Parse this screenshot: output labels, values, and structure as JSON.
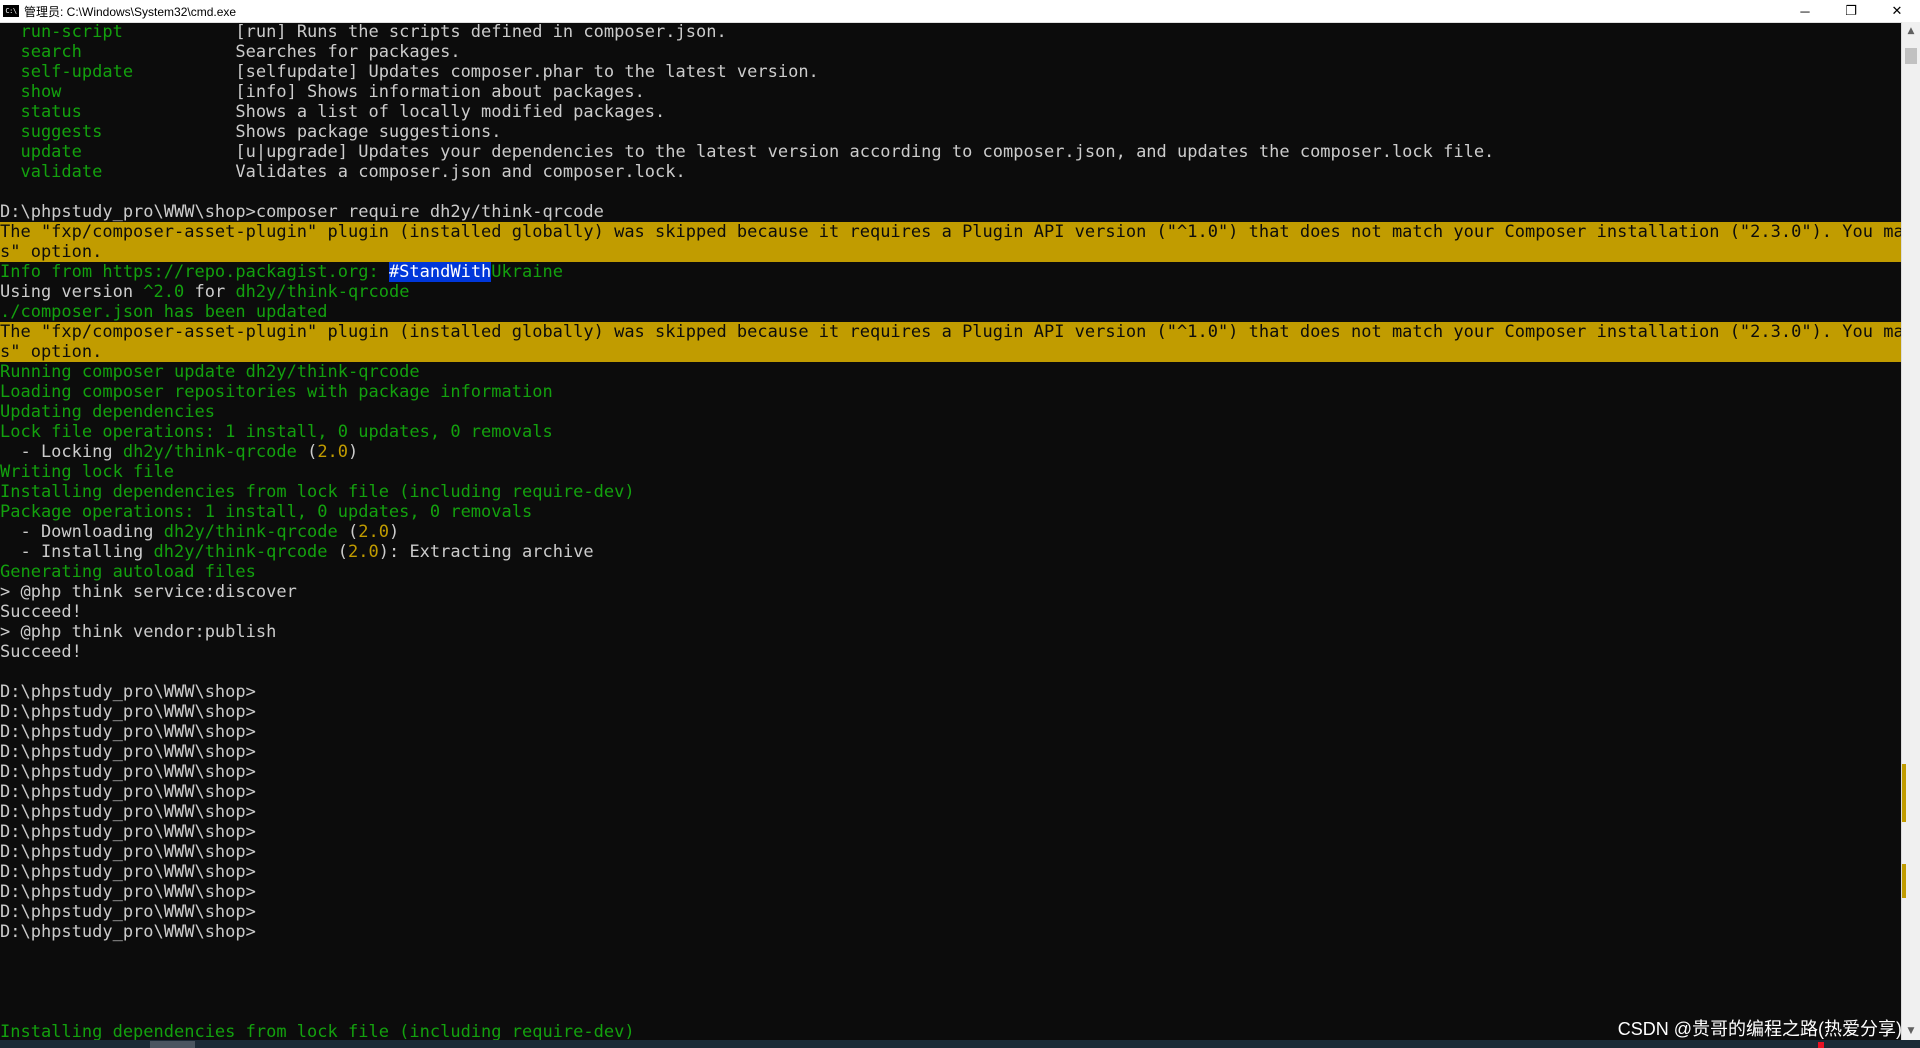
{
  "window": {
    "title": "管理员: C:\\Windows\\System32\\cmd.exe",
    "icon_label": "C:\\",
    "minimize": "─",
    "maximize": "❐",
    "close": "✕"
  },
  "console": {
    "lines": [
      {
        "segments": [
          {
            "text": "  run-script           ",
            "color": "g"
          },
          {
            "text": "[run] Runs the scripts defined in composer.json."
          }
        ]
      },
      {
        "segments": [
          {
            "text": "  search               ",
            "color": "g"
          },
          {
            "text": "Searches for packages."
          }
        ]
      },
      {
        "segments": [
          {
            "text": "  self-update          ",
            "color": "g"
          },
          {
            "text": "[selfupdate] Updates composer.phar to the latest version."
          }
        ]
      },
      {
        "segments": [
          {
            "text": "  show                 ",
            "color": "g"
          },
          {
            "text": "[info] Shows information about packages."
          }
        ]
      },
      {
        "segments": [
          {
            "text": "  status               ",
            "color": "g"
          },
          {
            "text": "Shows a list of locally modified packages."
          }
        ]
      },
      {
        "segments": [
          {
            "text": "  suggests             ",
            "color": "g"
          },
          {
            "text": "Shows package suggestions."
          }
        ]
      },
      {
        "segments": [
          {
            "text": "  update               ",
            "color": "g"
          },
          {
            "text": "[u|upgrade] Updates your dependencies to the latest version according to composer.json, and updates the composer.lock file."
          }
        ]
      },
      {
        "segments": [
          {
            "text": "  validate             ",
            "color": "g"
          },
          {
            "text": "Validates a composer.json and composer.lock."
          }
        ]
      },
      {
        "segments": [
          {
            "text": ""
          }
        ]
      },
      {
        "segments": [
          {
            "text": "D:\\phpstudy_pro\\WWW\\shop>composer require dh2y/think-qrcode"
          }
        ]
      },
      {
        "style": "warn",
        "segments": [
          {
            "text": "The \"fxp/composer-asset-plugin\" plugin (installed globally) was skipped because it requires a Plugin API version (\"^1.0\") that does not match your Composer installation (\"2.3.0\"). You may ne"
          }
        ]
      },
      {
        "style": "warn",
        "segments": [
          {
            "text": "s\" option."
          }
        ]
      },
      {
        "segments": [
          {
            "text": "Info from https://repo.packagist.org: ",
            "color": "g"
          },
          {
            "text": "#StandWith",
            "color": "hl"
          },
          {
            "text": "Ukraine",
            "color": "g"
          }
        ]
      },
      {
        "segments": [
          {
            "text": "Using version "
          },
          {
            "text": "^2.0",
            "color": "g"
          },
          {
            "text": " for "
          },
          {
            "text": "dh2y/think-qrcode",
            "color": "g"
          }
        ]
      },
      {
        "segments": [
          {
            "text": "./composer.json has been updated",
            "color": "g"
          }
        ]
      },
      {
        "style": "warn",
        "segments": [
          {
            "text": "The \"fxp/composer-asset-plugin\" plugin (installed globally) was skipped because it requires a Plugin API version (\"^1.0\") that does not match your Composer installation (\"2.3.0\"). You may ne"
          }
        ]
      },
      {
        "style": "warn",
        "segments": [
          {
            "text": "s\" option."
          }
        ]
      },
      {
        "segments": [
          {
            "text": "Running composer update dh2y/think-qrcode",
            "color": "g"
          }
        ]
      },
      {
        "segments": [
          {
            "text": "Loading composer repositories with package information",
            "color": "g"
          }
        ]
      },
      {
        "segments": [
          {
            "text": "Updating dependencies",
            "color": "g"
          }
        ]
      },
      {
        "segments": [
          {
            "text": "Lock file operations: 1 install, 0 updates, 0 removals",
            "color": "g"
          }
        ]
      },
      {
        "segments": [
          {
            "text": "  - Locking "
          },
          {
            "text": "dh2y/think-qrcode",
            "color": "g"
          },
          {
            "text": " ("
          },
          {
            "text": "2.0",
            "color": "y"
          },
          {
            "text": ")"
          }
        ]
      },
      {
        "segments": [
          {
            "text": "Writing lock file",
            "color": "g"
          }
        ]
      },
      {
        "segments": [
          {
            "text": "Installing dependencies from lock file (including require-dev)",
            "color": "g"
          }
        ]
      },
      {
        "segments": [
          {
            "text": "Package operations: 1 install, 0 updates, 0 removals",
            "color": "g"
          }
        ]
      },
      {
        "segments": [
          {
            "text": "  - Downloading "
          },
          {
            "text": "dh2y/think-qrcode",
            "color": "g"
          },
          {
            "text": " ("
          },
          {
            "text": "2.0",
            "color": "y"
          },
          {
            "text": ")"
          }
        ]
      },
      {
        "segments": [
          {
            "text": "  - Installing "
          },
          {
            "text": "dh2y/think-qrcode",
            "color": "g"
          },
          {
            "text": " ("
          },
          {
            "text": "2.0",
            "color": "y"
          },
          {
            "text": "): Extracting archive"
          }
        ]
      },
      {
        "segments": [
          {
            "text": "Generating autoload files",
            "color": "g"
          }
        ]
      },
      {
        "segments": [
          {
            "text": "> @php think service:discover"
          }
        ]
      },
      {
        "segments": [
          {
            "text": "Succeed!"
          }
        ]
      },
      {
        "segments": [
          {
            "text": "> @php think vendor:publish"
          }
        ]
      },
      {
        "segments": [
          {
            "text": "Succeed!"
          }
        ]
      },
      {
        "segments": [
          {
            "text": ""
          }
        ]
      },
      {
        "segments": [
          {
            "text": "D:\\phpstudy_pro\\WWW\\shop>"
          }
        ]
      },
      {
        "segments": [
          {
            "text": "D:\\phpstudy_pro\\WWW\\shop>"
          }
        ]
      },
      {
        "segments": [
          {
            "text": "D:\\phpstudy_pro\\WWW\\shop>"
          }
        ]
      },
      {
        "segments": [
          {
            "text": "D:\\phpstudy_pro\\WWW\\shop>"
          }
        ]
      },
      {
        "segments": [
          {
            "text": "D:\\phpstudy_pro\\WWW\\shop>"
          }
        ]
      },
      {
        "segments": [
          {
            "text": "D:\\phpstudy_pro\\WWW\\shop>"
          }
        ]
      },
      {
        "segments": [
          {
            "text": "D:\\phpstudy_pro\\WWW\\shop>"
          }
        ]
      },
      {
        "segments": [
          {
            "text": "D:\\phpstudy_pro\\WWW\\shop>"
          }
        ]
      },
      {
        "segments": [
          {
            "text": "D:\\phpstudy_pro\\WWW\\shop>"
          }
        ]
      },
      {
        "segments": [
          {
            "text": "D:\\phpstudy_pro\\WWW\\shop>"
          }
        ]
      },
      {
        "segments": [
          {
            "text": "D:\\phpstudy_pro\\WWW\\shop>"
          }
        ]
      },
      {
        "segments": [
          {
            "text": "D:\\phpstudy_pro\\WWW\\shop>"
          }
        ]
      },
      {
        "segments": [
          {
            "text": "D:\\phpstudy_pro\\WWW\\shop>"
          }
        ]
      },
      {
        "segments": [
          {
            "text": ""
          }
        ]
      },
      {
        "segments": [
          {
            "text": ""
          }
        ]
      },
      {
        "segments": [
          {
            "text": ""
          }
        ]
      },
      {
        "segments": [
          {
            "text": ""
          }
        ]
      },
      {
        "segments": [
          {
            "text": "Installing dependencies from lock file (including require-dev)",
            "color": "g"
          }
        ]
      }
    ]
  },
  "watermark": "CSDN @贵哥的编程之路(热爱分享)",
  "colors": {
    "background": "#0c0c0c",
    "default_text": "#cccccc",
    "green": "#13a10e",
    "yellow": "#c19c00",
    "warn_background": "#c19c00",
    "selection_background": "#0037da"
  }
}
